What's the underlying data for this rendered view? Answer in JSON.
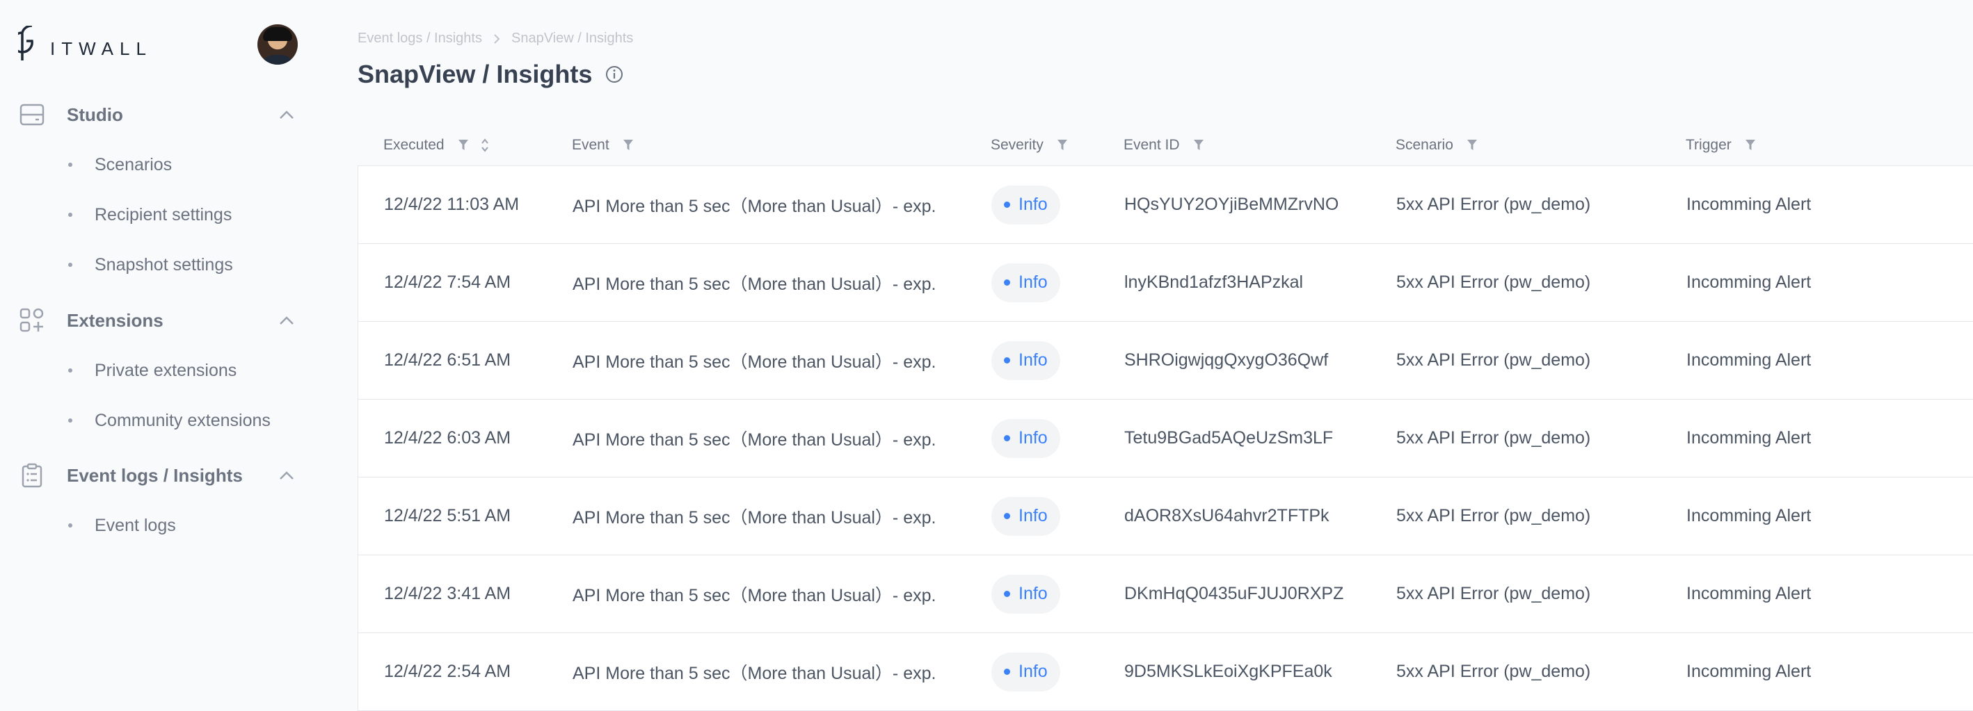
{
  "app": {
    "logo_text": "ITWALL",
    "logo_letter": "P"
  },
  "sidebar": {
    "sections": [
      {
        "label": "Studio",
        "icon": "server-icon",
        "items": [
          {
            "label": "Scenarios"
          },
          {
            "label": "Recipient settings"
          },
          {
            "label": "Snapshot settings"
          }
        ]
      },
      {
        "label": "Extensions",
        "icon": "apps-add-icon",
        "items": [
          {
            "label": "Private extensions"
          },
          {
            "label": "Community extensions"
          }
        ]
      },
      {
        "label": "Event logs / Insights",
        "icon": "clipboard-list-icon",
        "items": [
          {
            "label": "Event logs"
          }
        ]
      }
    ]
  },
  "breadcrumb": {
    "items": [
      "Event logs / Insights",
      "SnapView / Insights"
    ]
  },
  "page": {
    "title": "SnapView / Insights"
  },
  "table": {
    "columns": [
      "Executed",
      "Event",
      "Severity",
      "Event ID",
      "Scenario",
      "Trigger"
    ],
    "rows": [
      {
        "executed": "12/4/22 11:03 AM",
        "event": "API More than 5 sec（More than Usual）- exp.",
        "severity": "Info",
        "event_id": "HQsYUY2OYjiBeMMZrvNO",
        "scenario": "5xx API Error (pw_demo)",
        "trigger": "Incomming Alert"
      },
      {
        "executed": "12/4/22 7:54 AM",
        "event": "API More than 5 sec（More than Usual）- exp.",
        "severity": "Info",
        "event_id": "lnyKBnd1afzf3HAPzkal",
        "scenario": "5xx API Error (pw_demo)",
        "trigger": "Incomming Alert"
      },
      {
        "executed": "12/4/22 6:51 AM",
        "event": "API More than 5 sec（More than Usual）- exp.",
        "severity": "Info",
        "event_id": "SHROigwjqgQxygO36Qwf",
        "scenario": "5xx API Error (pw_demo)",
        "trigger": "Incomming Alert"
      },
      {
        "executed": "12/4/22 6:03 AM",
        "event": "API More than 5 sec（More than Usual）- exp.",
        "severity": "Info",
        "event_id": "Tetu9BGad5AQeUzSm3LF",
        "scenario": "5xx API Error (pw_demo)",
        "trigger": "Incomming Alert"
      },
      {
        "executed": "12/4/22 5:51 AM",
        "event": "API More than 5 sec（More than Usual）- exp.",
        "severity": "Info",
        "event_id": "dAOR8XsU64ahvr2TFTPk",
        "scenario": "5xx API Error (pw_demo)",
        "trigger": "Incomming Alert"
      },
      {
        "executed": "12/4/22 3:41 AM",
        "event": "API More than 5 sec（More than Usual）- exp.",
        "severity": "Info",
        "event_id": "DKmHqQ0435uFJUJ0RXPZ",
        "scenario": "5xx API Error (pw_demo)",
        "trigger": "Incomming Alert"
      },
      {
        "executed": "12/4/22 2:54 AM",
        "event": "API More than 5 sec（More than Usual）- exp.",
        "severity": "Info",
        "event_id": "9D5MKSLkEoiXgKPFEa0k",
        "scenario": "5xx API Error (pw_demo)",
        "trigger": "Incomming Alert"
      }
    ]
  },
  "colors": {
    "accent": "#3b82f6",
    "text_muted": "#6b7280",
    "background": "#f9fafb"
  }
}
